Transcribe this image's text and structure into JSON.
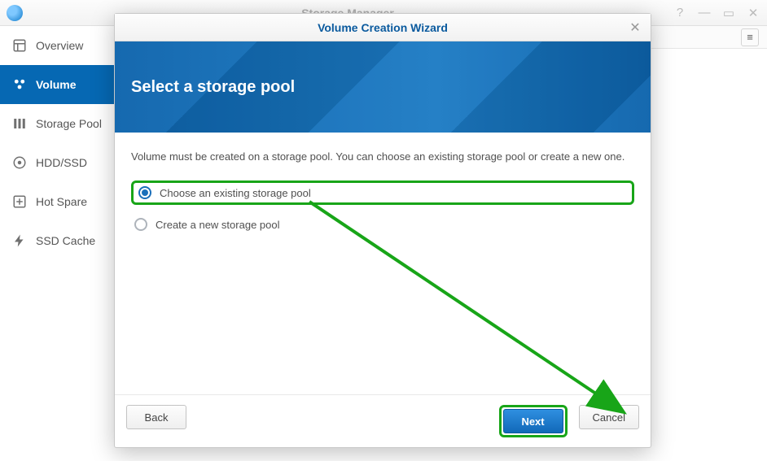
{
  "window": {
    "title": "Storage Manager"
  },
  "sidebar": {
    "items": [
      {
        "label": "Overview"
      },
      {
        "label": "Volume"
      },
      {
        "label": "Storage Pool"
      },
      {
        "label": "HDD/SSD"
      },
      {
        "label": "Hot Spare"
      },
      {
        "label": "SSD Cache"
      }
    ]
  },
  "modal": {
    "title": "Volume Creation Wizard",
    "banner_title": "Select a storage pool",
    "hint": "Volume must be created on a storage pool. You can choose an existing storage pool or create a new one.",
    "options": {
      "existing": "Choose an existing storage pool",
      "create": "Create a new storage pool"
    },
    "buttons": {
      "back": "Back",
      "next": "Next",
      "cancel": "Cancel"
    }
  }
}
